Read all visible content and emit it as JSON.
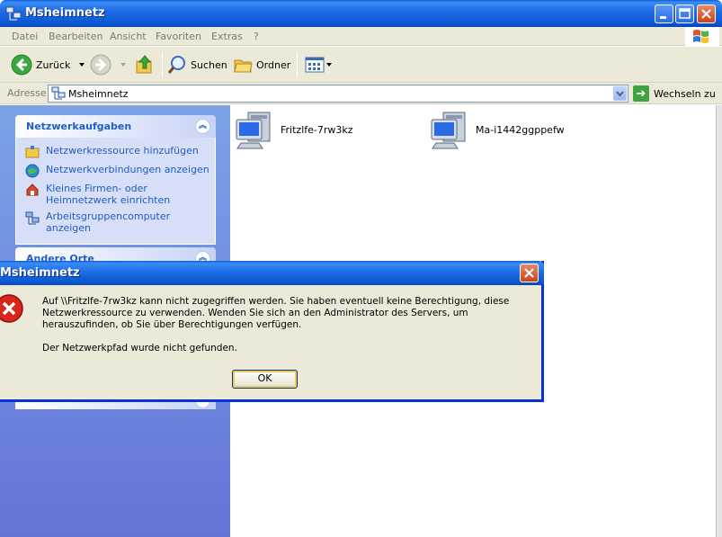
{
  "window": {
    "title": "Msheimnetz"
  },
  "menu": [
    "Datei",
    "Bearbeiten",
    "Ansicht",
    "Favoriten",
    "Extras",
    "?"
  ],
  "toolbar": {
    "back_label": "Zurück",
    "search_label": "Suchen",
    "folders_label": "Ordner"
  },
  "address": {
    "label": "Adresse",
    "value": "Msheimnetz",
    "go_label": "Wechseln zu"
  },
  "taskpane": {
    "network_tasks": {
      "title": "Netzwerkaufgaben",
      "items": [
        "Netzwerkressource hinzufügen",
        "Netzwerkverbindungen anzeigen",
        "Kleines Firmen- oder Heimnetzwerk einrichten",
        "Arbeitsgruppencomputer anzeigen"
      ]
    },
    "other_places": {
      "title": "Andere Orte"
    }
  },
  "content": {
    "items": [
      {
        "label": "Fritzlfe-7rw3kz"
      },
      {
        "label": "Ma-i1442ggppefw"
      }
    ]
  },
  "dialog": {
    "title": "Msheimnetz",
    "message": "Auf \\\\Fritzlfe-7rw3kz kann nicht zugegriffen werden. Sie haben eventuell keine Berechtigung, diese Netzwerkressource zu verwenden. Wenden Sie sich an den Administrator des Servers, um herauszufinden, ob Sie über Berechtigungen verfügen.",
    "detail": "Der Netzwerkpfad wurde nicht gefunden.",
    "ok_label": "OK"
  },
  "colors": {
    "titlebar": "#0a58d2",
    "taskpane_bg": "#6f8ee0",
    "link": "#215dc6",
    "error_red": "#d9261c"
  }
}
